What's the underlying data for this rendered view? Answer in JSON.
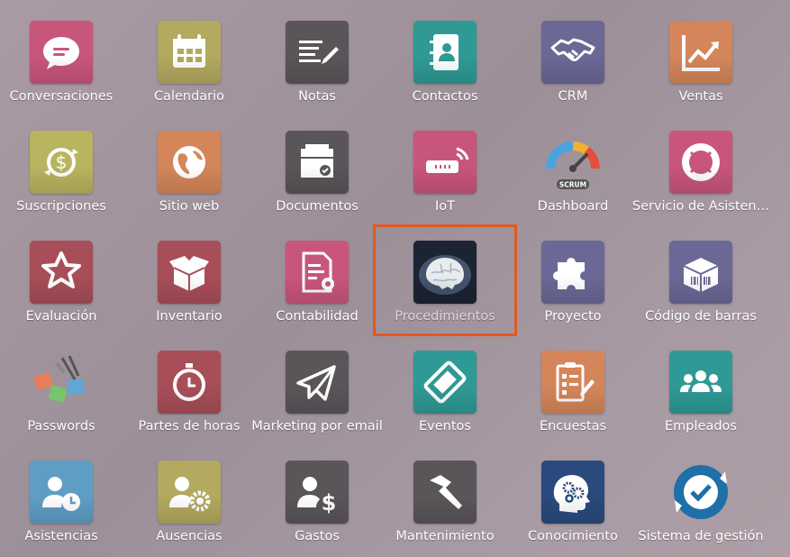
{
  "apps": [
    {
      "label": "Conversaciones",
      "icon": "chat-bubble-icon",
      "color": "#c8567a"
    },
    {
      "label": "Calendario",
      "icon": "calendar-icon",
      "color": "#b3a95f"
    },
    {
      "label": "Notas",
      "icon": "notes-pencil-icon",
      "color": "#5a5559"
    },
    {
      "label": "Contactos",
      "icon": "address-book-icon",
      "color": "#2f9a95"
    },
    {
      "label": "CRM",
      "icon": "handshake-icon",
      "color": "#6b6896"
    },
    {
      "label": "Ventas",
      "icon": "sales-chart-icon",
      "color": "#d4865a"
    },
    {
      "label": "Suscripciones",
      "icon": "subscription-refresh-icon",
      "color": "#b8b460"
    },
    {
      "label": "Sitio web",
      "icon": "globe-icon",
      "color": "#d4865a"
    },
    {
      "label": "Documentos",
      "icon": "document-tray-icon",
      "color": "#5a5559"
    },
    {
      "label": "IoT",
      "icon": "iot-device-icon",
      "color": "#c8567a"
    },
    {
      "label": "Dashboard",
      "icon": "scrum-gauge-icon",
      "color": "#ffffff",
      "badge": "SCRUM"
    },
    {
      "label": "Servicio de Asisten…",
      "icon": "lifebuoy-icon",
      "color": "#c8567a"
    },
    {
      "label": "Evaluación",
      "icon": "star-badge-icon",
      "color": "#a84e58"
    },
    {
      "label": "Inventario",
      "icon": "open-box-icon",
      "color": "#a84e58"
    },
    {
      "label": "Contabilidad",
      "icon": "accounting-document-icon",
      "color": "#c8567a"
    },
    {
      "label": "Procedimientos",
      "icon": "brain-icon",
      "color": "#1c2333"
    },
    {
      "label": "Proyecto",
      "icon": "puzzle-piece-icon",
      "color": "#6b6896"
    },
    {
      "label": "Código de barras",
      "icon": "barcode-box-icon",
      "color": "#6b6896"
    },
    {
      "label": "Passwords",
      "icon": "padlocks-icon",
      "color": "#ffffff"
    },
    {
      "label": "Partes de horas",
      "icon": "stopwatch-icon",
      "color": "#a84e58"
    },
    {
      "label": "Marketing por email",
      "icon": "paper-plane-icon",
      "color": "#5a5559"
    },
    {
      "label": "Eventos",
      "icon": "ticket-icon",
      "color": "#2f9a95"
    },
    {
      "label": "Encuestas",
      "icon": "survey-clipboard-icon",
      "color": "#d4865a"
    },
    {
      "label": "Empleados",
      "icon": "people-group-icon",
      "color": "#2f9a95"
    },
    {
      "label": "Asistencias",
      "icon": "person-clock-icon",
      "color": "#5f9ec4"
    },
    {
      "label": "Ausencias",
      "icon": "person-gear-icon",
      "color": "#b3a95f"
    },
    {
      "label": "Gastos",
      "icon": "person-dollar-icon",
      "color": "#5a5559"
    },
    {
      "label": "Mantenimiento",
      "icon": "hammer-icon",
      "color": "#5a5559"
    },
    {
      "label": "Conocimiento",
      "icon": "head-gears-icon",
      "color": "#2a4a7d"
    },
    {
      "label": "Sistema de gestión",
      "icon": "sync-check-icon",
      "color": "#ffffff"
    }
  ],
  "selected": "Procedimientos"
}
